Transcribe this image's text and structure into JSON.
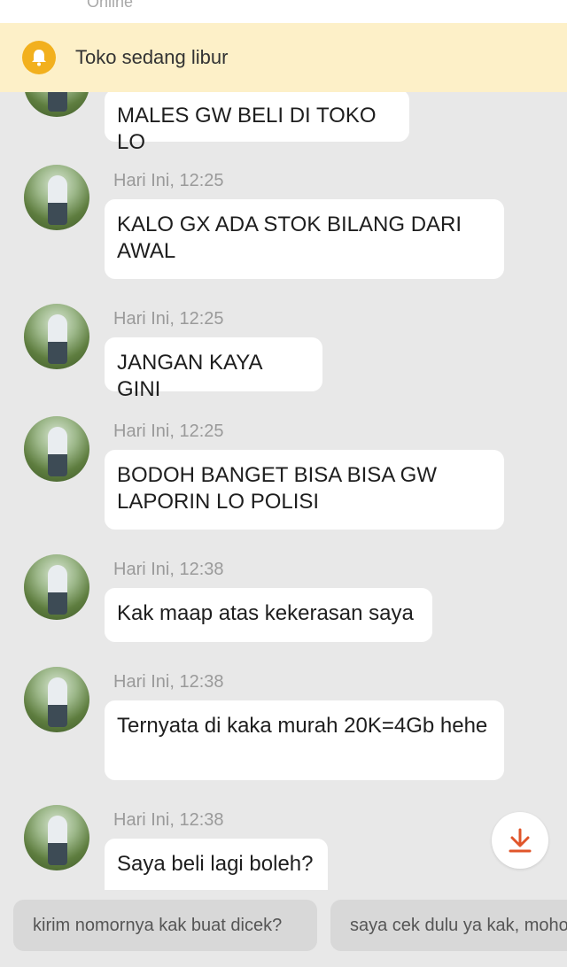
{
  "header": {
    "status": "Online"
  },
  "notice": {
    "text": "Toko sedang libur",
    "icon": "bell-icon"
  },
  "messages": [
    {
      "time": "",
      "text": "MALES GW BELI DI TOKO LO"
    },
    {
      "time": "Hari Ini, 12:25",
      "text": "KALO GX ADA STOK BILANG DARI AWAL"
    },
    {
      "time": "Hari Ini, 12:25",
      "text": "JANGAN KAYA GINI"
    },
    {
      "time": "Hari Ini, 12:25",
      "text": "BODOH BANGET BISA BISA GW LAPORIN LO POLISI"
    },
    {
      "time": "Hari Ini, 12:38",
      "text": "Kak maap atas kekerasan saya"
    },
    {
      "time": "Hari Ini, 12:38",
      "text": "Ternyata di kaka murah 20K=4Gb hehe"
    },
    {
      "time": "Hari Ini, 12:38",
      "text": "Saya beli lagi boleh?"
    }
  ],
  "quick_replies": [
    "kirim nomornya kak buat dicek?",
    "saya cek dulu ya kak, mohon ditunggu"
  ],
  "colors": {
    "notice_bg": "#fdf0c8",
    "bell": "#f2b01e",
    "accent": "#e0552a"
  }
}
